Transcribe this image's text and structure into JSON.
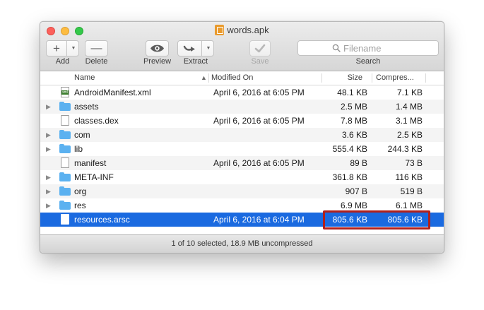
{
  "window": {
    "title": "words.apk"
  },
  "toolbar": {
    "add_label": "Add",
    "delete_label": "Delete",
    "preview_label": "Preview",
    "extract_label": "Extract",
    "save_label": "Save",
    "search_label": "Search",
    "search_placeholder": "Filename"
  },
  "columns": {
    "name": "Name",
    "modified": "Modified On",
    "size": "Size",
    "compressed": "Compres..."
  },
  "rows": [
    {
      "name": "AndroidManifest.xml",
      "modified": "April 6, 2016 at 6:05 PM",
      "size": "48.1 KB",
      "compressed": "7.1 KB",
      "kind": "xml"
    },
    {
      "name": "assets",
      "modified": "",
      "size": "2.5 MB",
      "compressed": "1.4 MB",
      "kind": "folder"
    },
    {
      "name": "classes.dex",
      "modified": "April 6, 2016 at 6:05 PM",
      "size": "7.8 MB",
      "compressed": "3.1 MB",
      "kind": "file"
    },
    {
      "name": "com",
      "modified": "",
      "size": "3.6 KB",
      "compressed": "2.5 KB",
      "kind": "folder"
    },
    {
      "name": "lib",
      "modified": "",
      "size": "555.4 KB",
      "compressed": "244.3 KB",
      "kind": "folder"
    },
    {
      "name": "manifest",
      "modified": "April 6, 2016 at 6:05 PM",
      "size": "89 B",
      "compressed": "73 B",
      "kind": "file"
    },
    {
      "name": "META-INF",
      "modified": "",
      "size": "361.8 KB",
      "compressed": "116 KB",
      "kind": "folder"
    },
    {
      "name": "org",
      "modified": "",
      "size": "907 B",
      "compressed": "519 B",
      "kind": "folder"
    },
    {
      "name": "res",
      "modified": "",
      "size": "6.9 MB",
      "compressed": "6.1 MB",
      "kind": "folder"
    },
    {
      "name": "resources.arsc",
      "modified": "April 6, 2016 at 6:04 PM",
      "size": "805.6 KB",
      "compressed": "805.6 KB",
      "kind": "file",
      "selected": true
    }
  ],
  "status": {
    "text": "1 of 10 selected, 18.9 MB uncompressed"
  },
  "colors": {
    "selection": "#1a6ae0",
    "highlight_box": "#b0201c",
    "folder": "#5bb1f0"
  },
  "icons": {
    "add": "plus-icon",
    "delete": "minus-icon",
    "preview": "eye-icon",
    "extract": "extract-arrow-icon",
    "save": "checkmark-icon",
    "search": "magnifier-icon"
  }
}
